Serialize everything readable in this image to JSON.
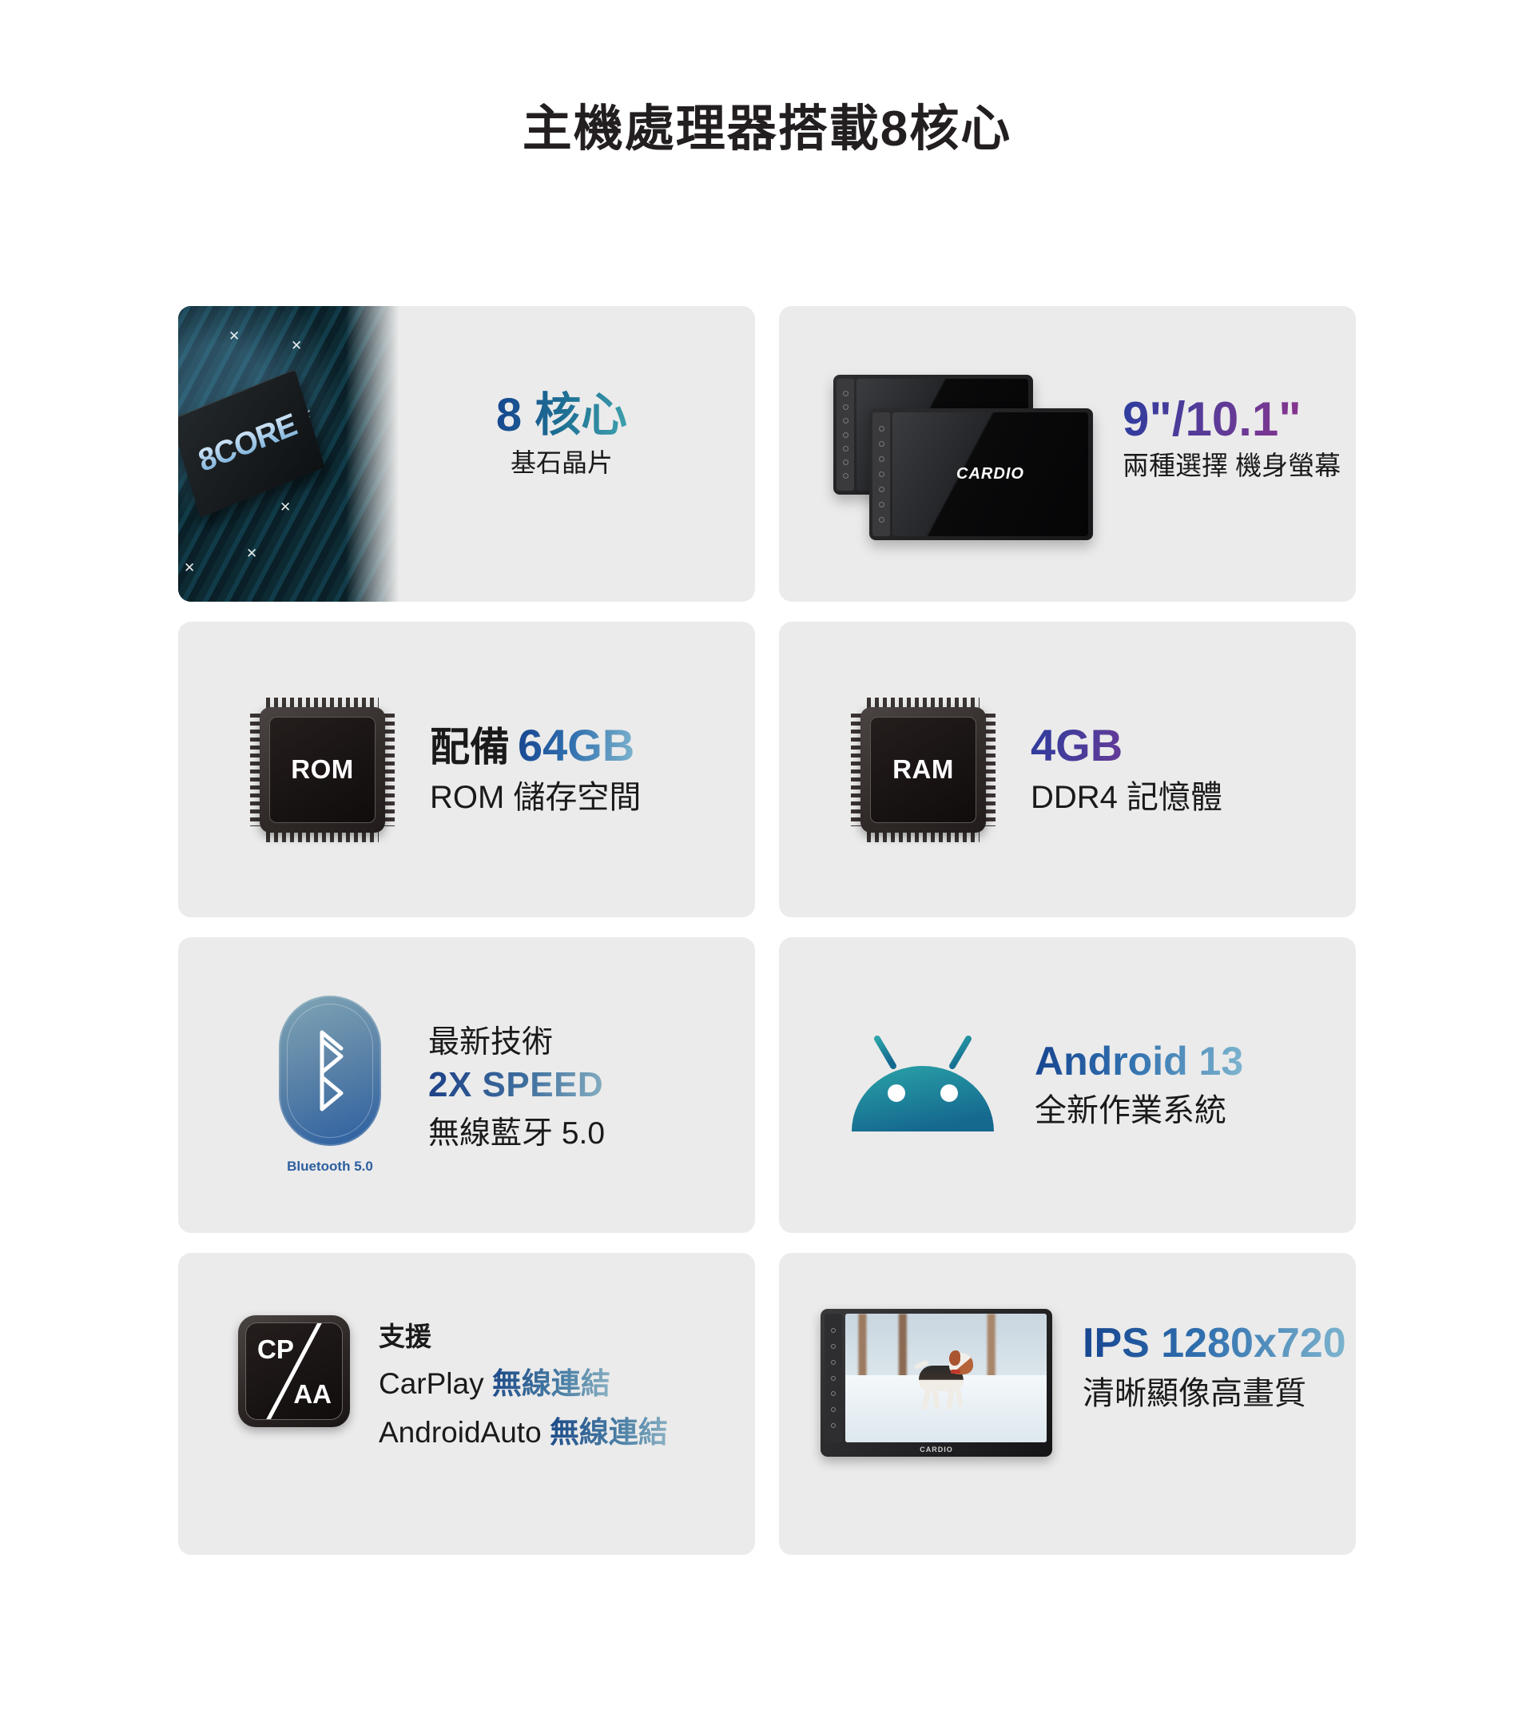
{
  "page": {
    "title": "主機處理器搭載8核心",
    "background": "#ffffff",
    "card_background": "#ebebeb"
  },
  "colors": {
    "title": "#231f20",
    "accent_blue": "#17448f",
    "accent_teal": "#3fa2ae",
    "accent_purple": "#9c2f86",
    "bluetooth": "#2b5ea0"
  },
  "cards": [
    {
      "id": "cpu",
      "icon": "cpu-chip-photo",
      "chip_label": "8CORE",
      "headline": "8 核心",
      "subline": "基石晶片"
    },
    {
      "id": "screen-size",
      "icon": "head-unit-pair",
      "device_brand": "CARDIO",
      "headline": "9\"/10.1\"",
      "subline": "兩種選擇 機身螢幕"
    },
    {
      "id": "rom",
      "icon": "rom-chip",
      "chip_label": "ROM",
      "headline_prefix": "配備",
      "headline_value": "64GB",
      "subline": "ROM 儲存空間"
    },
    {
      "id": "ram",
      "icon": "ram-chip",
      "chip_label": "RAM",
      "headline": "4GB",
      "subline": "DDR4 記憶體"
    },
    {
      "id": "bluetooth",
      "icon": "bluetooth-icon",
      "icon_label": "Bluetooth 5.0",
      "line1": "最新技術",
      "line2": "2X SPEED",
      "line3": "無線藍牙 5.0"
    },
    {
      "id": "android",
      "icon": "android-robot-icon",
      "headline": "Android 13",
      "subline": "全新作業系統"
    },
    {
      "id": "carplay",
      "icon": "carplay-androidauto-icon",
      "icon_top_label": "CP",
      "icon_bottom_label": "AA",
      "line1": "支援",
      "line2_name": "CarPlay",
      "line2_value": "無線連結",
      "line3_name": "AndroidAuto",
      "line3_value": "無線連結"
    },
    {
      "id": "display",
      "icon": "head-unit-dog-photo",
      "device_brand": "CARDIO",
      "headline": "IPS 1280x720",
      "subline": "清晰顯像高畫質"
    }
  ]
}
